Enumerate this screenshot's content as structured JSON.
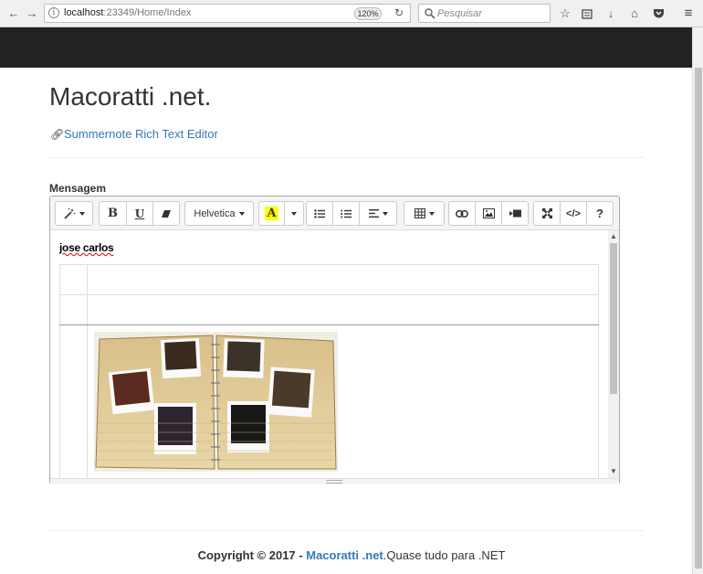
{
  "browser": {
    "url_host": "localhost",
    "url_rest": ":23349/Home/Index",
    "zoom": "120%",
    "search_placeholder": "Pesquisar"
  },
  "page": {
    "title": "Macoratti .net.",
    "subtitle_link": "Summernote Rich Text Editor",
    "field_label": "Mensagem"
  },
  "editor": {
    "font_name": "Helvetica",
    "content_heading": "jose carlos",
    "table_rows": 3,
    "image_description": "photo album"
  },
  "footer": {
    "copyright": "Copyright © 2017 - ",
    "brand": "Macoratti .net",
    "tagline": ".Quase tudo para .NET"
  },
  "colors": {
    "navbar": "#222222",
    "link": "#337ab7",
    "highlight_yellow": "#ffff00"
  }
}
